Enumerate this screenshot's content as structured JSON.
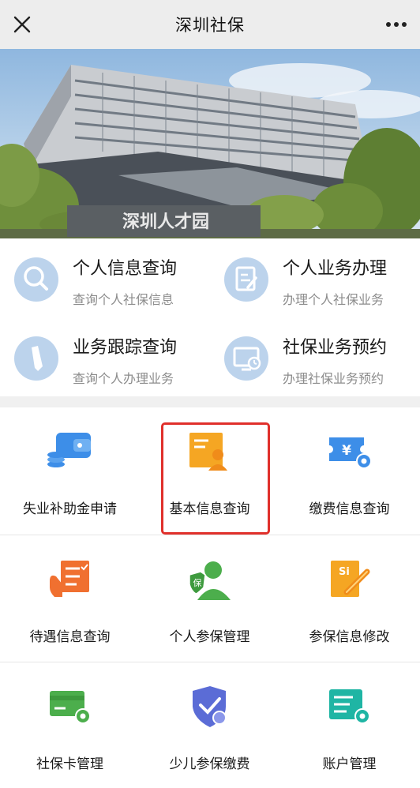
{
  "header": {
    "title": "深圳社保",
    "close_icon": "close-icon",
    "more_icon": "more-icon"
  },
  "banner": {
    "sign_text": "深圳人才园"
  },
  "quick_services": [
    {
      "title": "个人信息查询",
      "subtitle": "查询个人社保信息",
      "icon": "search-icon"
    },
    {
      "title": "个人业务办理",
      "subtitle": "办理个人社保业务",
      "icon": "document-edit-icon"
    },
    {
      "title": "业务跟踪查询",
      "subtitle": "查询个人办理业务",
      "icon": "pencil-icon"
    },
    {
      "title": "社保业务预约",
      "subtitle": "办理社保业务预约",
      "icon": "monitor-clock-icon"
    }
  ],
  "services": [
    {
      "label": "失业补助金申请",
      "icon": "wallet-coins-icon"
    },
    {
      "label": "基本信息查询",
      "icon": "profile-document-icon"
    },
    {
      "label": "缴费信息查询",
      "icon": "yuan-ticket-gear-icon"
    },
    {
      "label": "待遇信息查询",
      "icon": "hand-checklist-icon"
    },
    {
      "label": "个人参保管理",
      "icon": "insured-person-icon"
    },
    {
      "label": "参保信息修改",
      "icon": "si-document-edit-icon"
    },
    {
      "label": "社保卡管理",
      "icon": "card-gear-icon"
    },
    {
      "label": "少儿参保缴费",
      "icon": "shield-check-icon"
    },
    {
      "label": "账户管理",
      "icon": "list-gear-icon"
    }
  ],
  "highlighted_service": "基本信息查询",
  "colors": {
    "header_bg": "#ededed",
    "quick_icon_bg": "#bcd3ec",
    "highlight_border": "#e0302b",
    "blue": "#3d8ee8",
    "orange": "#f5a623",
    "green": "#4cae4c"
  }
}
